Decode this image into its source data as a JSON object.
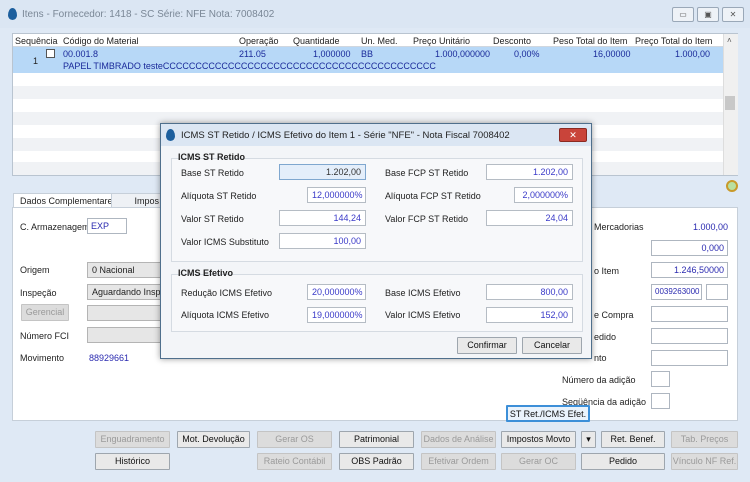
{
  "window": {
    "title": "Itens - Fornecedor: 1418 - SC Série: NFE  Nota: 7008402",
    "controls": [
      "minimize",
      "maximize",
      "close"
    ]
  },
  "grid": {
    "columns": [
      "Sequência",
      "Código do Material",
      "Operação",
      "Quantidade",
      "Un. Med.",
      "Preço Unitário",
      "Desconto",
      "Peso Total do Item",
      "Preço Total do Item"
    ],
    "rows": [
      {
        "seq": "1",
        "codigo": "00.001.8",
        "operacao": "211.05",
        "quantidade": "1,000000",
        "un": "BB",
        "preco_unitario": "1.000,000000",
        "desconto": "0,00%",
        "peso_total": "16,00000",
        "preco_total": "1.000,00",
        "descricao": "PAPEL TIMBRADO testeCCCCCCCCCCCCCCCCCCCCCCCCCCCCCCCCCCCCCCCCCC"
      }
    ]
  },
  "tabs": [
    "Dados Complementares",
    "Impos"
  ],
  "left": {
    "armazenagem_label": "C. Armazenagem",
    "armazenagem": "EXP",
    "origem_label": "Origem",
    "origem": "0 Nacional",
    "inspecao_label": "Inspeção",
    "inspecao": "Aguardando Inspe",
    "gerencial": "Gerencial",
    "fci_label": "Número FCI",
    "movimento_label": "Movimento",
    "movimento": "88929661"
  },
  "right": {
    "mercadorias_label": "Mercadorias",
    "mercadorias": "1.000,00",
    "campo2": "0,000",
    "item_label": "o Item",
    "item": "1.246,50000",
    "ncm": "0039263000",
    "compra_label": "e Compra",
    "pedido_label": "edido",
    "nto_label": "nto",
    "adicao_label": "Número da adição",
    "seq_adicao_label": "Seqüência da adição"
  },
  "st_button": "ST Ret./ICMS Efet.",
  "buttons": {
    "row1": [
      {
        "label": "Enguadramento",
        "enabled": false
      },
      {
        "label": "Mot. Devolução",
        "enabled": true
      },
      {
        "label": "Gerar OS",
        "enabled": false
      },
      {
        "label": "Patrimonial",
        "enabled": true
      },
      {
        "label": "Dados de Análise",
        "enabled": false
      },
      {
        "label": "Impostos Movto",
        "enabled": true
      },
      {
        "label": "▾",
        "enabled": true
      },
      {
        "label": "Ret. Benef.",
        "enabled": true
      },
      {
        "label": "Tab. Preços",
        "enabled": false
      }
    ],
    "row2": [
      {
        "label": "Histórico",
        "enabled": true
      },
      {
        "label": "Rateio Contábil",
        "enabled": false
      },
      {
        "label": "OBS Padrão",
        "enabled": true
      },
      {
        "label": "Efetivar Ordem",
        "enabled": false
      },
      {
        "label": "Gerar OC",
        "enabled": false
      },
      {
        "label": "Pedido",
        "enabled": true
      },
      {
        "label": "Vínculo NF Ref.",
        "enabled": false
      }
    ]
  },
  "dialog": {
    "title": "ICMS ST Retido / ICMS Efetivo do Item 1 - Série \"NFE\" - Nota Fiscal 7008402",
    "st": {
      "title": "ICMS ST Retido",
      "base_label": "Base ST Retido",
      "base": "1.202,00",
      "aliq_label": "Alíquota ST Retido",
      "aliq": "12,000000%",
      "valor_label": "Valor ST Retido",
      "valor": "144,24",
      "subst_label": "Valor ICMS Substituto",
      "subst": "100,00",
      "fcp_base_label": "Base FCP ST Retido",
      "fcp_base": "1.202,00",
      "fcp_aliq_label": "Alíquota FCP ST Retido",
      "fcp_aliq": "2,000000%",
      "fcp_valor_label": "Valor FCP ST Retido",
      "fcp_valor": "24,04"
    },
    "ef": {
      "title": "ICMS Efetivo",
      "red_label": "Redução ICMS Efetivo",
      "red": "20,000000%",
      "aliq_label": "Alíquota ICMS Efetivo",
      "aliq": "19,000000%",
      "base_label": "Base ICMS Efetivo",
      "base": "800,00",
      "valor_label": "Valor ICMS Efetivo",
      "valor": "152,00"
    },
    "confirm": "Confirmar",
    "cancel": "Cancelar"
  }
}
